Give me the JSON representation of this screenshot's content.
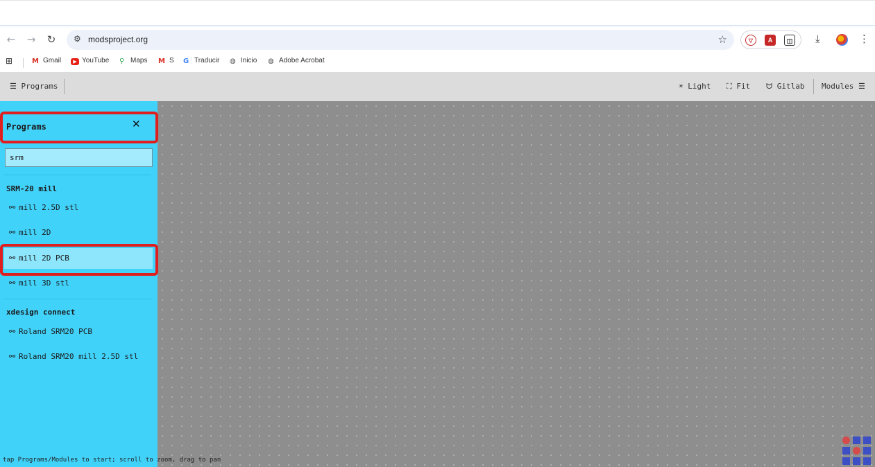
{
  "browser": {
    "url": "modsproject.org",
    "bookmarks": [
      {
        "label": "Gmail",
        "icon": "gmail-icon"
      },
      {
        "label": "YouTube",
        "icon": "youtube-icon"
      },
      {
        "label": "Maps",
        "icon": "maps-icon"
      },
      {
        "label": "S",
        "icon": "gmail-icon"
      },
      {
        "label": "Traducir",
        "icon": "translate-icon"
      },
      {
        "label": "Inicio",
        "icon": "globe-icon"
      },
      {
        "label": "Adobe Acrobat",
        "icon": "globe-icon"
      }
    ]
  },
  "header": {
    "programs_label": "☰ Programs",
    "light_label": "☀ Light",
    "fit_label": "⛶ Fit",
    "gitlab_label": "Gitlab",
    "modules_label": "Modules ☰"
  },
  "sidebar": {
    "title": "Programs",
    "close_glyph": "✕",
    "search_value": "srm",
    "groups": [
      {
        "name": "SRM-20 mill",
        "items": [
          "mill 2.5D stl",
          "mill 2D",
          "mill 2D PCB",
          "mill 3D stl"
        ]
      },
      {
        "name": "xdesign connect",
        "items": [
          "Roland SRM20 PCB",
          "Roland SRM20 mill 2.5D stl"
        ]
      }
    ],
    "selected_item": "mill 2D PCB"
  },
  "status_text": "tap Programs/Modules to start; scroll to zoom, drag to pan",
  "colors": {
    "sidebar_bg": "#41d2fa",
    "canvas_bg": "#8e8e8e",
    "highlight": "#e01e1e"
  }
}
